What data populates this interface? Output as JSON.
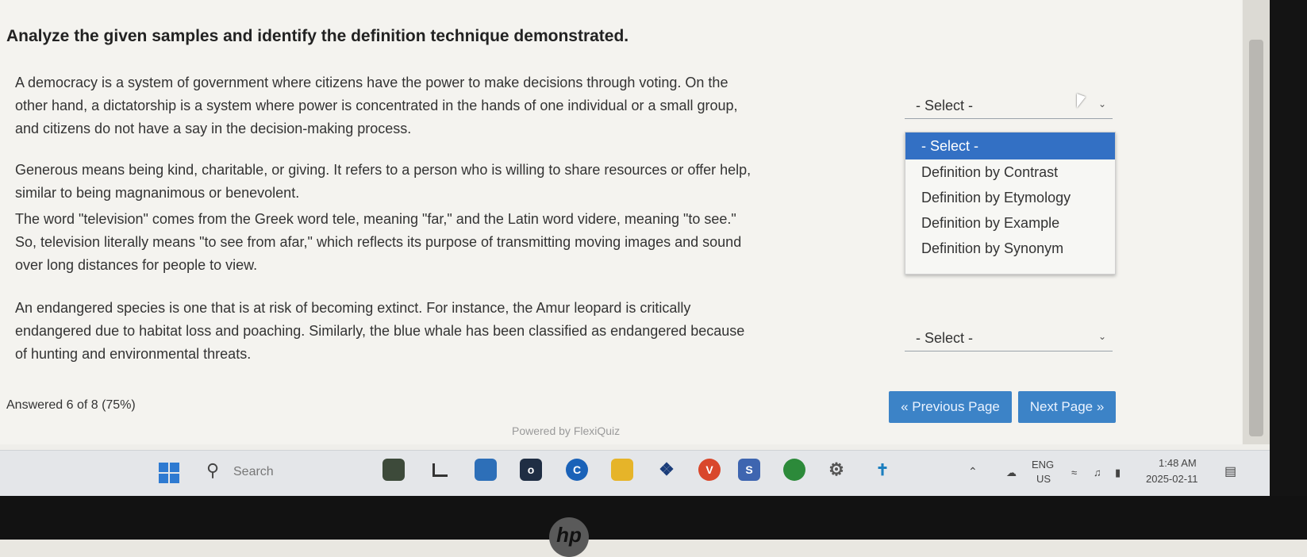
{
  "title": "Analyze the given samples and identify the definition technique demonstrated.",
  "questions": [
    {
      "lines": [
        "A democracy is a system of government where citizens have the power to make decisions through voting. On the",
        "other hand, a dictatorship is a system where power is concentrated in the hands of one individual or a small group,",
        "and citizens do not have a say in the decision-making process."
      ],
      "select_value": "- Select -"
    },
    {
      "lines": [
        "Generous means being kind, charitable, or giving. It refers to a person who is willing to share resources or offer help,",
        "similar to being magnanimous or benevolent."
      ]
    },
    {
      "lines": [
        "The word \"television\" comes from the Greek word tele, meaning \"far,\" and the Latin word videre, meaning \"to see.\"",
        "So, television literally means \"to see from afar,\" which reflects its purpose of transmitting moving images and sound",
        "over long distances for people to view."
      ]
    },
    {
      "lines": [
        "An endangered species is one that is at risk of becoming extinct. For instance, the Amur leopard is critically",
        "endangered due to habitat loss and poaching. Similarly, the blue whale has been classified as endangered because",
        "of hunting and environmental threats."
      ],
      "select_value": "- Select -"
    }
  ],
  "dropdown_options": [
    "- Select -",
    "Definition by Contrast",
    "Definition by Etymology",
    "Definition by Example",
    "Definition by Synonym"
  ],
  "footer": {
    "answered": "Answered 6 of 8 (75%)",
    "prev_label": "« Previous Page",
    "next_label": "Next Page »",
    "powered_by": "Powered by FlexiQuiz"
  },
  "taskbar": {
    "search_placeholder": "Search",
    "lang": "ENG",
    "region": "US",
    "time": "1:48 AM",
    "date": "2025-02-11"
  },
  "colors": {
    "accent": "#3c83c7",
    "selected_option": "#3370c4"
  }
}
